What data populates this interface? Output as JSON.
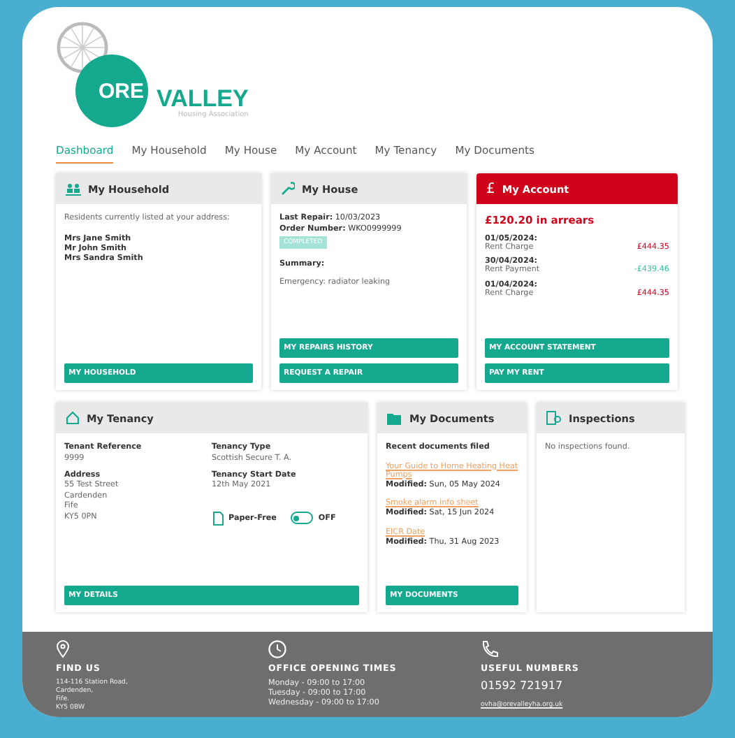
{
  "logo": {
    "word_1": "ORE",
    "word_2": "VALLEY",
    "tagline": "Housing Association"
  },
  "nav": [
    {
      "label": "Dashboard",
      "selected": true
    },
    {
      "label": "My Household",
      "selected": false
    },
    {
      "label": "My House",
      "selected": false
    },
    {
      "label": "My Account",
      "selected": false
    },
    {
      "label": "My Tenancy",
      "selected": false
    },
    {
      "label": "My Documents",
      "selected": false
    }
  ],
  "household": {
    "title": "My Household",
    "intro": "Residents currently listed at your address:",
    "residents": [
      "Mrs Jane Smith",
      "Mr John Smith",
      "Mrs Sandra Smith"
    ],
    "buttons": [
      "MY HOUSEHOLD"
    ]
  },
  "house": {
    "title": "My House",
    "last_repair_label": "Last Repair:",
    "last_repair": "10/03/2023",
    "order_label": "Order Number:",
    "order": "WKO0999999",
    "status": "COMPLETED",
    "summary_label": "Summary:",
    "summary": "Emergency: radiator leaking",
    "buttons": [
      "MY REPAIRS HISTORY",
      "REQUEST A REPAIR"
    ]
  },
  "account": {
    "icon": "£",
    "title": "My Account",
    "balance": "£120.20 in arrears",
    "transactions": [
      {
        "date": "01/05/2024:",
        "label": "Rent Charge",
        "amount": "£444.35",
        "kind": "charge"
      },
      {
        "date": "30/04/2024:",
        "label": "Rent Payment",
        "amount": "-£439.46",
        "kind": "payment"
      },
      {
        "date": "01/04/2024:",
        "label": "Rent Charge",
        "amount": "£444.35",
        "kind": "charge"
      }
    ],
    "buttons": [
      "MY ACCOUNT STATEMENT",
      "PAY MY RENT"
    ]
  },
  "tenancy": {
    "title": "My Tenancy",
    "fields": [
      {
        "label": "Tenant Reference",
        "lines": [
          "9999"
        ]
      },
      {
        "label": "Tenancy Type",
        "lines": [
          "Scottish Secure T. A."
        ]
      },
      {
        "label": "Address",
        "lines": [
          "55 Test Street",
          "Cardenden",
          "Fife",
          "KY5 0PN"
        ]
      },
      {
        "label": "Tenancy Start Date",
        "lines": [
          "12th May 2021"
        ]
      }
    ],
    "paper_free": {
      "label": "Paper-Free",
      "on": false,
      "state_text": "OFF"
    },
    "buttons": [
      "MY DETAILS"
    ]
  },
  "documents": {
    "title": "My Documents",
    "heading": "Recent documents filed",
    "items": [
      {
        "name": "Your Guide to Home Heating Heat  Pumps",
        "modified_label": "Modified:",
        "modified": "Sun, 05 May 2024"
      },
      {
        "name": "Smoke alarm info sheet",
        "modified_label": "Modified:",
        "modified": "Sat, 15 Jun 2024"
      },
      {
        "name": "EICR Date",
        "modified_label": "Modified:",
        "modified": "Thu, 31 Aug 2023"
      }
    ],
    "buttons": [
      "MY DOCUMENTS"
    ]
  },
  "inspections": {
    "title": "Inspections",
    "message": "No inspections found."
  },
  "footer": [
    {
      "kind": "location",
      "heading": "FIND US",
      "lines": [
        "114-116 Station Road,",
        "Cardenden,",
        "Fife.",
        "KY5 0BW"
      ]
    },
    {
      "kind": "clock",
      "heading": "OFFICE OPENING TIMES",
      "lines": [
        "Monday - 09:00 to 17:00",
        "Tuesday - 09:00 to 17:00",
        "Wednesday - 09:00 to 17:00"
      ]
    },
    {
      "kind": "phone",
      "heading": "USEFUL NUMBERS",
      "phone": "01592 721917",
      "email": "ovha@orevalleyha.org.uk"
    }
  ]
}
